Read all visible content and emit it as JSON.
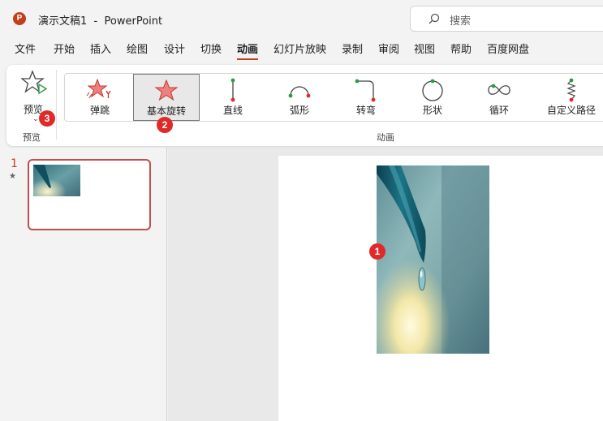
{
  "window": {
    "app_logo_letter": "P",
    "doc_name": "演示文稿1",
    "separator": "-",
    "app_name": "PowerPoint"
  },
  "search": {
    "placeholder": "搜索"
  },
  "menu": {
    "items": [
      "文件",
      "开始",
      "插入",
      "绘图",
      "设计",
      "切换",
      "动画",
      "幻灯片放映",
      "录制",
      "审阅",
      "视图",
      "帮助",
      "百度网盘"
    ],
    "active": "动画"
  },
  "ribbon": {
    "preview_button_label": "预览",
    "preview_group_label": "预览",
    "animation_group_label": "动画",
    "animations": [
      {
        "label": "弹跳",
        "icon": "bounce-icon"
      },
      {
        "label": "基本旋转",
        "icon": "spin-star-icon",
        "selected": true
      },
      {
        "label": "直线",
        "icon": "line-path-icon"
      },
      {
        "label": "弧形",
        "icon": "arc-path-icon"
      },
      {
        "label": "转弯",
        "icon": "turn-path-icon"
      },
      {
        "label": "形状",
        "icon": "shape-path-icon"
      },
      {
        "label": "循环",
        "icon": "loop-path-icon"
      },
      {
        "label": "自定义路径",
        "icon": "custom-path-icon"
      }
    ]
  },
  "badges": {
    "canvas": "1",
    "gallery": "2",
    "preview": "3"
  },
  "slides": [
    {
      "number": "1",
      "has_animation": "★"
    }
  ],
  "colors": {
    "accent": "#c43e1c",
    "badge": "#e02a2a",
    "thumb_border": "#c0504d"
  }
}
